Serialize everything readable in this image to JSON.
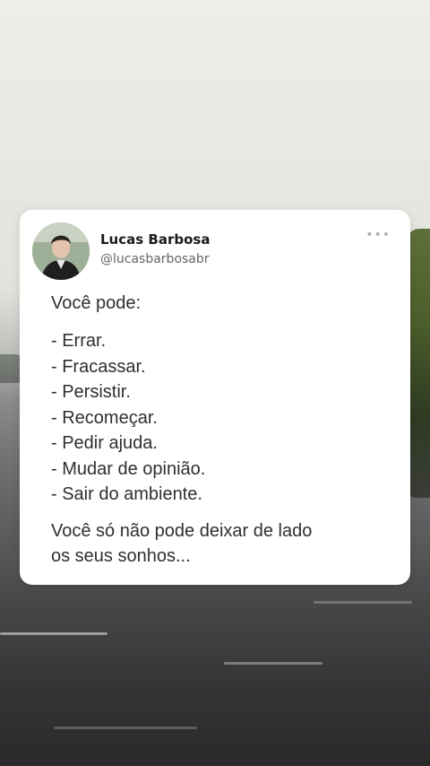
{
  "post": {
    "author_name": "Lucas Barbosa",
    "author_handle": "@lucasbarbosabr",
    "more_icon": "more-icon",
    "intro": "Você pode:",
    "items": [
      "- Errar.",
      "- Fracassar.",
      "- Persistir.",
      "- Recomeçar.",
      "- Pedir ajuda.",
      "- Mudar de opinião.",
      "- Sair do ambiente."
    ],
    "outro_line1": "Você só não pode deixar de lado",
    "outro_line2": "os seus sonhos..."
  },
  "colors": {
    "card_bg": "#ffffff",
    "text": "#2f2f2f",
    "handle": "#646464"
  }
}
